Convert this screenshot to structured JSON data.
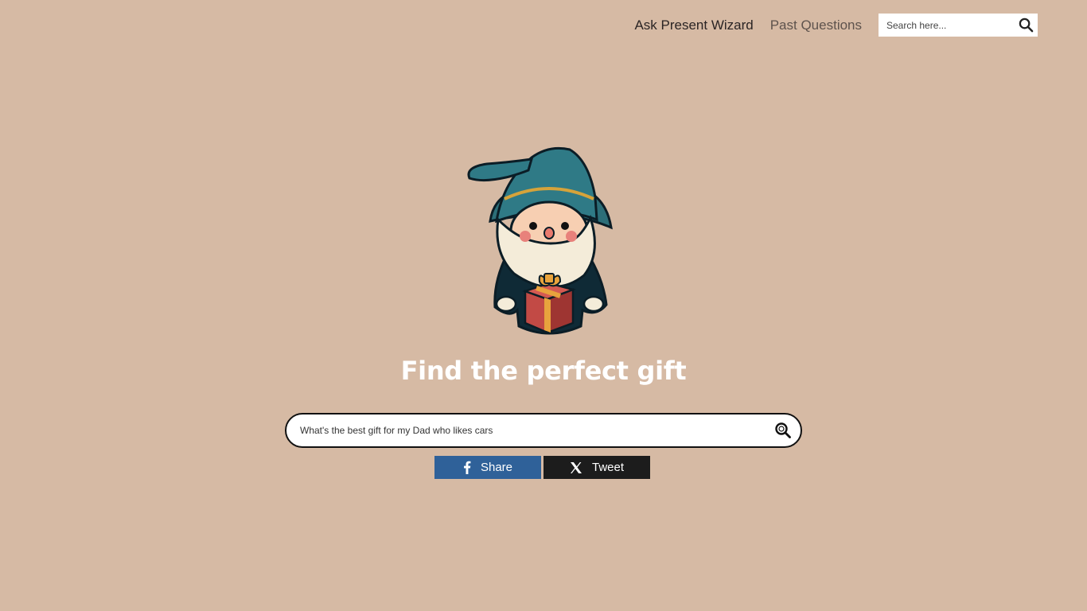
{
  "nav": {
    "items": [
      {
        "label": "Ask Present Wizard"
      },
      {
        "label": "Past Questions"
      }
    ],
    "search": {
      "placeholder": "Search here...",
      "icon": "search-icon"
    }
  },
  "hero": {
    "image": "wizard-with-gift",
    "headline": "Find the perfect gift"
  },
  "query": {
    "value": "What's the best gift for my Dad who likes cars",
    "icon": "search-icon"
  },
  "share": {
    "facebook": {
      "label": "Share",
      "icon": "facebook-icon",
      "color": "#2f6199"
    },
    "x": {
      "label": "Tweet",
      "icon": "x-icon",
      "color": "#1c1c1c"
    }
  },
  "colors": {
    "background": "#d6baa4",
    "headline": "#ffffff"
  }
}
